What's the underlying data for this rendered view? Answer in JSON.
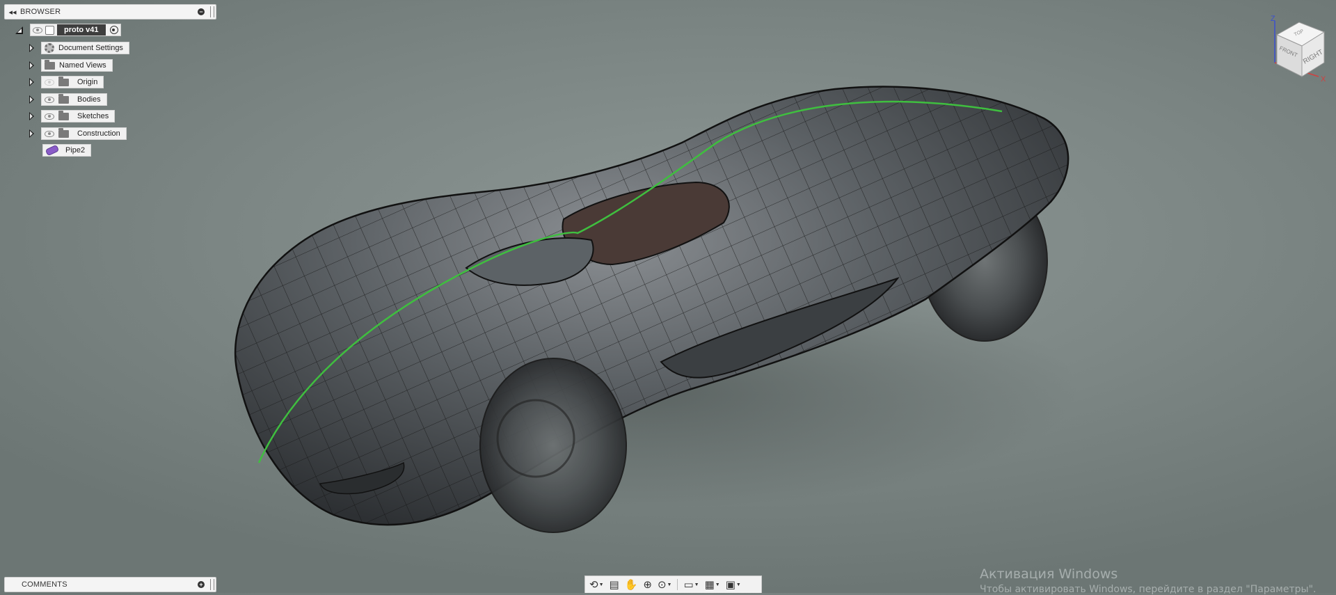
{
  "browser": {
    "title": "BROWSER",
    "collapse_glyph": "◂◂",
    "minimize_glyph": "−",
    "root": {
      "label": "proto v41"
    },
    "items": [
      {
        "label": "Document Settings",
        "icon": "gear-icon",
        "expandable": true,
        "eye": false
      },
      {
        "label": "Named Views",
        "icon": "folder-icon",
        "expandable": true,
        "eye": false
      },
      {
        "label": "Origin",
        "icon": "folder-icon",
        "expandable": true,
        "eye": "hidden"
      },
      {
        "label": "Bodies",
        "icon": "folder-icon",
        "expandable": true,
        "eye": true
      },
      {
        "label": "Sketches",
        "icon": "folder-icon",
        "expandable": true,
        "eye": true
      },
      {
        "label": "Construction",
        "icon": "folder-icon",
        "expandable": true,
        "eye": true
      },
      {
        "label": "Pipe2",
        "icon": "pipe-body-icon",
        "expandable": false,
        "eye": false
      }
    ]
  },
  "comments": {
    "title": "COMMENTS",
    "add_glyph": "+"
  },
  "viewcube": {
    "top_label": "TOP",
    "front_label": "FRONT",
    "right_label": "RIGHT",
    "axis_z": "Z",
    "axis_x": "X"
  },
  "toolbar": {
    "tools": [
      {
        "name": "orbit-icon",
        "glyph": "⟲",
        "dropdown": true
      },
      {
        "name": "look-at-icon",
        "glyph": "▤",
        "dropdown": false
      },
      {
        "name": "pan-icon",
        "glyph": "✋",
        "dropdown": false
      },
      {
        "name": "zoom-icon",
        "glyph": "⊕",
        "dropdown": false
      },
      {
        "name": "fit-icon",
        "glyph": "⊙",
        "dropdown": true
      },
      {
        "name": "display-settings-icon",
        "glyph": "▭",
        "dropdown": true
      },
      {
        "name": "grid-icon",
        "glyph": "▦",
        "dropdown": true
      },
      {
        "name": "viewports-icon",
        "glyph": "▣",
        "dropdown": true
      }
    ]
  },
  "watermark": {
    "title": "Активация Windows",
    "subtitle": "Чтобы активировать Windows, перейдите в раздел \"Параметры\"."
  },
  "colors": {
    "viewport_bg": "#7f8987",
    "car_body": "#55595b",
    "mesh_lines": "#151515",
    "highlight_curve": "#3fbf3f",
    "root_label_bg": "#3e3e3e"
  }
}
